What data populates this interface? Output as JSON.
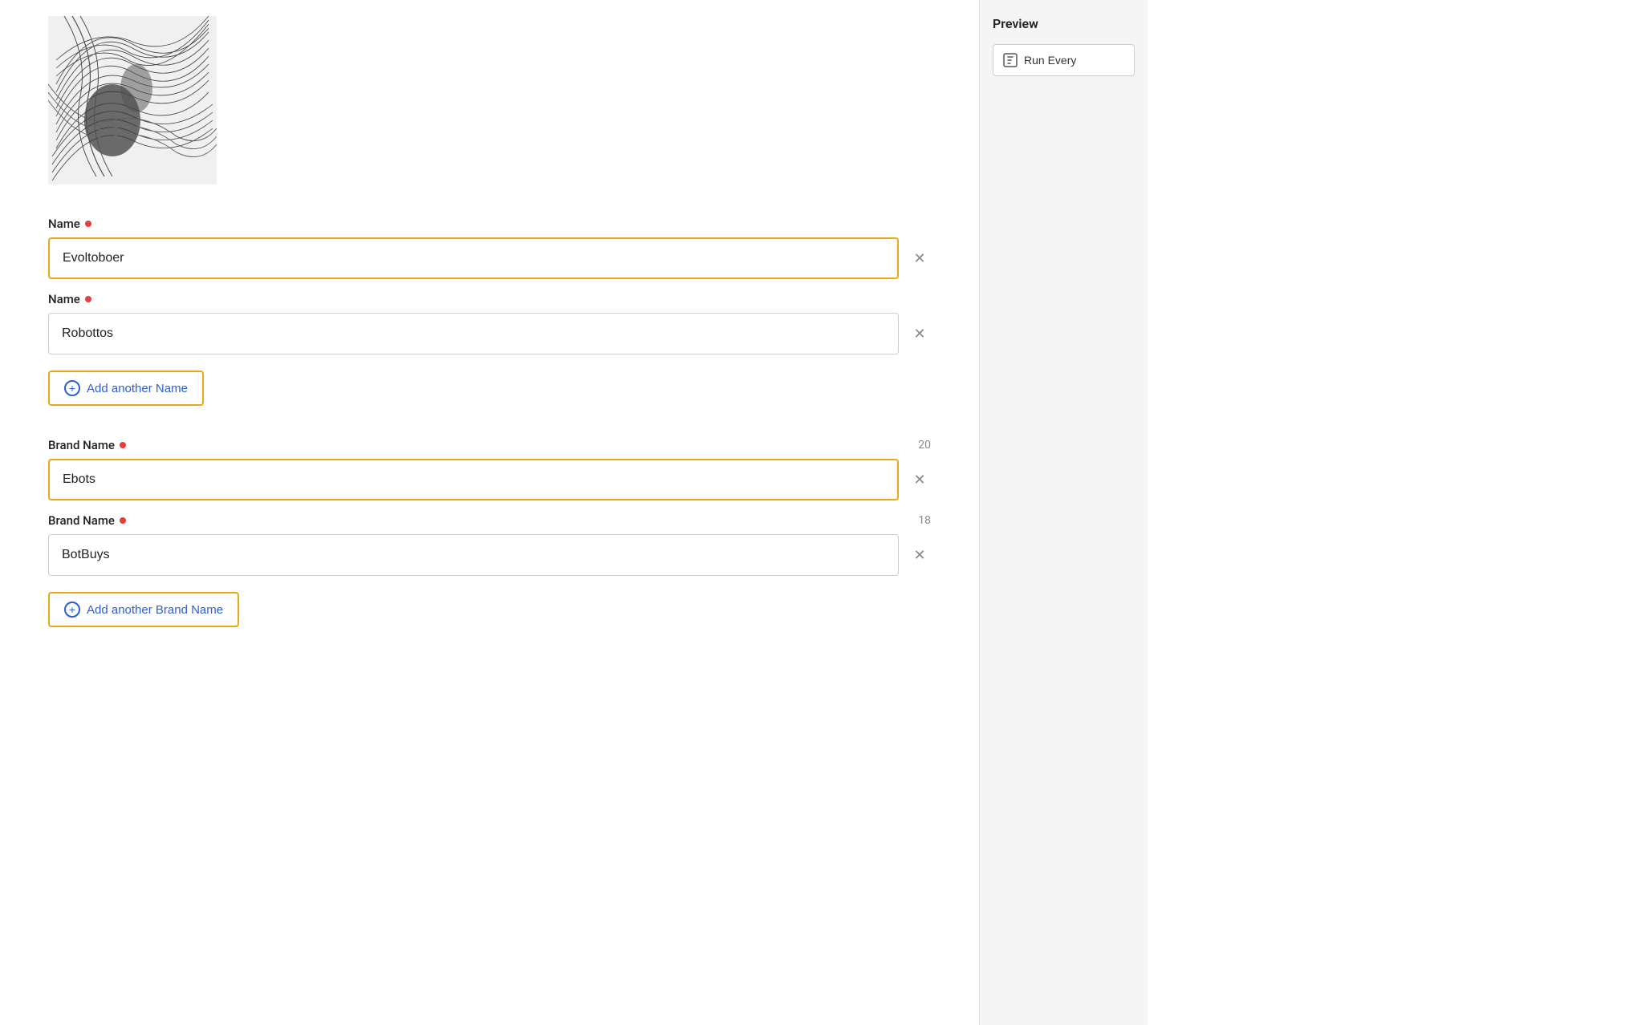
{
  "thumbnail": {
    "alt": "abstract black and white image"
  },
  "name_section": {
    "label": "Name",
    "fields": [
      {
        "value": "Evoltoboer",
        "active": true
      },
      {
        "value": "Robottos",
        "active": false
      }
    ],
    "add_button_label": "Add another Name"
  },
  "brand_name_section": {
    "label": "Brand Name",
    "fields": [
      {
        "value": "Ebots",
        "char_count": 20,
        "active": true
      },
      {
        "value": "BotBuys",
        "char_count": 18,
        "active": false
      }
    ],
    "add_button_label": "Add another Brand Name"
  },
  "sidebar": {
    "preview_title": "Preview",
    "run_every_label": "Run Every"
  }
}
